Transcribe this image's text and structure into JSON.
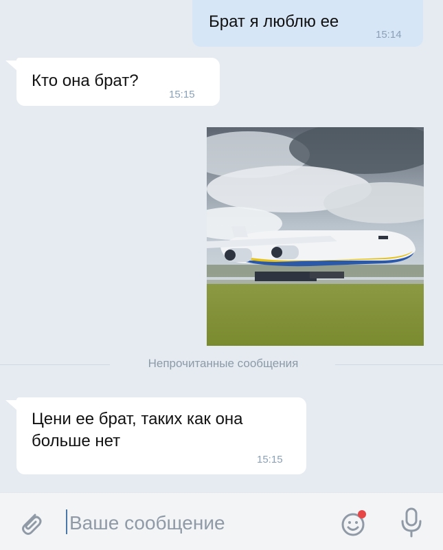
{
  "messages": [
    {
      "direction": "outgoing",
      "text": "Брат я люблю ее",
      "time": "15:14"
    },
    {
      "direction": "incoming",
      "text": "Кто она брат?",
      "time": "15:15"
    },
    {
      "direction": "outgoing",
      "type": "photo"
    },
    {
      "direction": "incoming",
      "text": "Цени ее брат, таких как она больше нет",
      "time": "15:15"
    }
  ],
  "unread_divider": "Непрочитанные сообщения",
  "composer": {
    "placeholder": "Ваше сообщение",
    "attach_icon": "paperclip-icon",
    "emoji_icon": "smile-icon",
    "mic_icon": "microphone-icon"
  },
  "colors": {
    "background": "#e5ebf1",
    "outgoing_bubble": "#d7e6f6",
    "incoming_bubble": "#ffffff",
    "accent": "#4a76a8",
    "emoji_badge": "#e64646"
  }
}
